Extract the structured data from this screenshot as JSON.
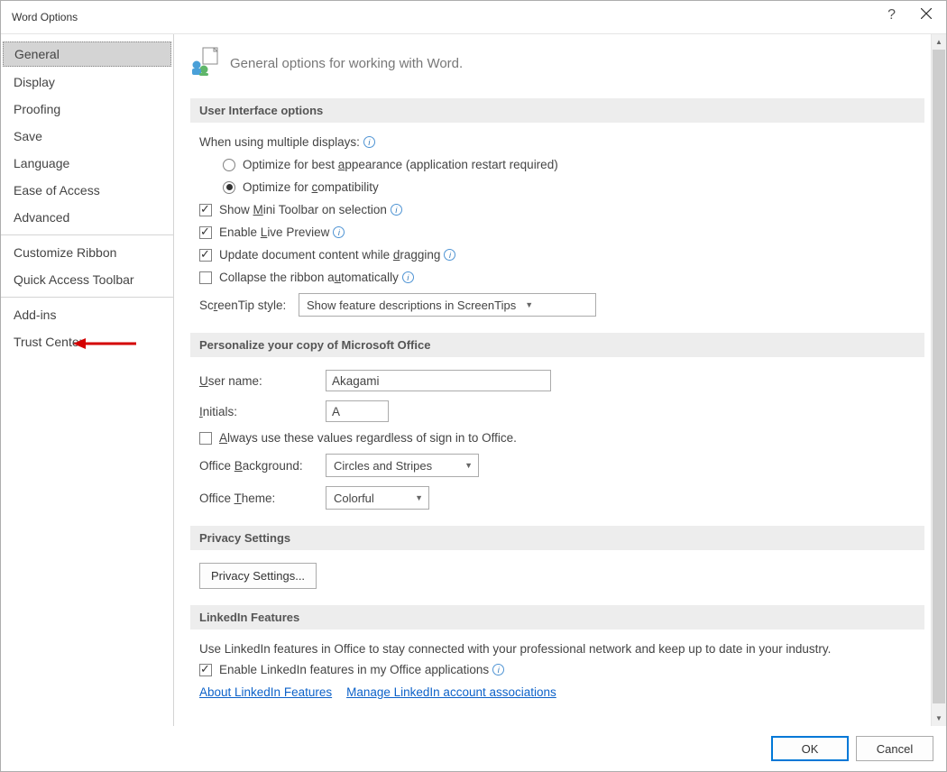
{
  "titlebar": {
    "title": "Word Options"
  },
  "sidebar": {
    "groups": [
      [
        "General",
        "Display",
        "Proofing",
        "Save",
        "Language",
        "Ease of Access",
        "Advanced"
      ],
      [
        "Customize Ribbon",
        "Quick Access Toolbar"
      ],
      [
        "Add-ins",
        "Trust Center"
      ]
    ],
    "selected": "General"
  },
  "main": {
    "header": "General options for working with Word.",
    "section_ui": {
      "title": "User Interface options",
      "displays_label": "When using multiple displays:",
      "radio_appearance": "Optimize for best appearance (application restart required)",
      "radio_compatibility": "Optimize for compatibility",
      "cb_mini_toolbar": "Show Mini Toolbar on selection",
      "cb_live_preview": "Enable Live Preview",
      "cb_update_dragging": "Update document content while dragging",
      "cb_collapse_ribbon": "Collapse the ribbon automatically",
      "screentip_label": "ScreenTip style:",
      "screentip_value": "Show feature descriptions in ScreenTips"
    },
    "section_personalize": {
      "title": "Personalize your copy of Microsoft Office",
      "username_label": "User name:",
      "username_value": "Akagami",
      "initials_label": "Initials:",
      "initials_value": "A",
      "cb_always": "Always use these values regardless of sign in to Office.",
      "bg_label": "Office Background:",
      "bg_value": "Circles and Stripes",
      "theme_label": "Office Theme:",
      "theme_value": "Colorful"
    },
    "section_privacy": {
      "title": "Privacy Settings",
      "button": "Privacy Settings..."
    },
    "section_linkedin": {
      "title": "LinkedIn Features",
      "desc": "Use LinkedIn features in Office to stay connected with your professional network and keep up to date in your industry.",
      "cb_enable": "Enable LinkedIn features in my Office applications",
      "link_about": "About LinkedIn Features",
      "link_manage": "Manage LinkedIn account associations"
    }
  },
  "footer": {
    "ok": "OK",
    "cancel": "Cancel"
  }
}
